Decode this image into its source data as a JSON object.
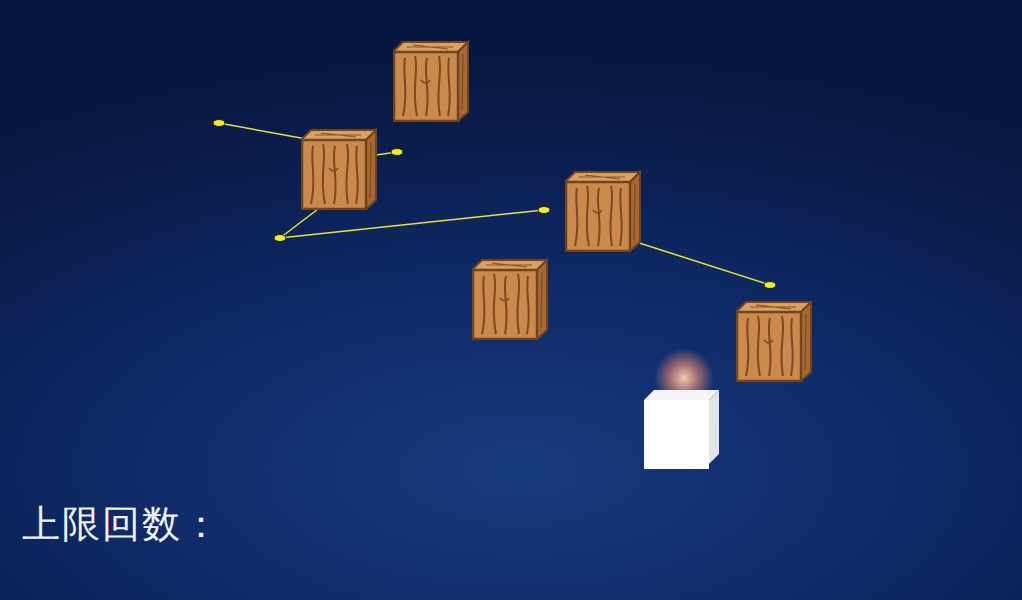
{
  "hud": {
    "label": "上限回数："
  },
  "blocks": [
    {
      "kind": "crate"
    },
    {
      "kind": "crate"
    },
    {
      "kind": "crate"
    },
    {
      "kind": "crate"
    },
    {
      "kind": "crate"
    },
    {
      "kind": "player"
    }
  ]
}
